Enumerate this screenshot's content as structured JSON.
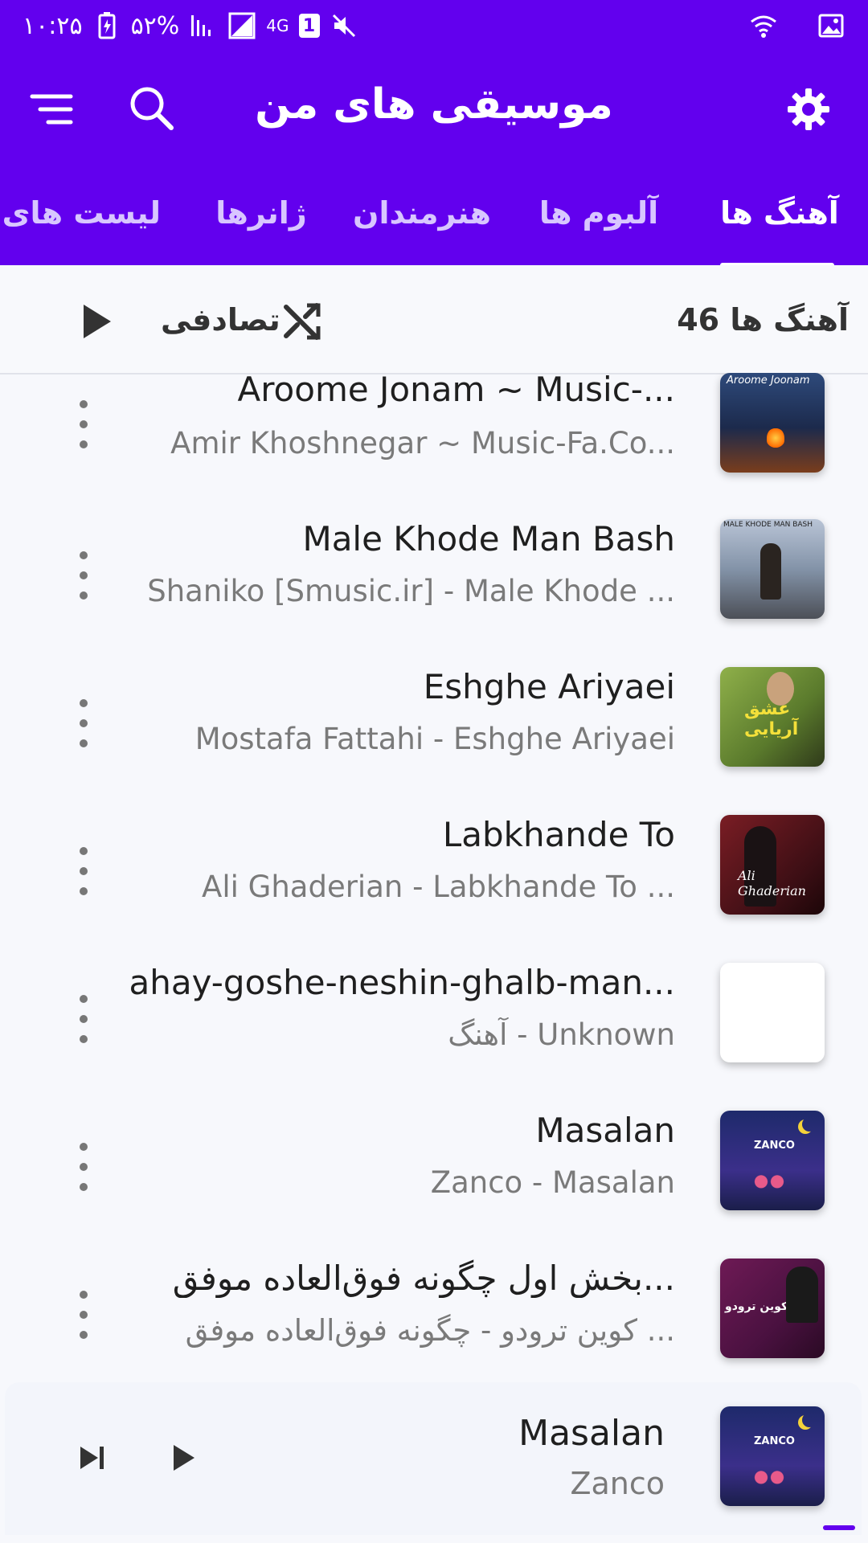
{
  "status_bar": {
    "time": "۱۰:۲۵",
    "battery": "۵۲%",
    "network": "4G",
    "sim": "1"
  },
  "app_bar": {
    "title": "موسیقی های من",
    "icons": [
      "menu-icon",
      "search-icon",
      "settings-icon"
    ]
  },
  "tabs": [
    {
      "label": "آهنگ ها",
      "active": true
    },
    {
      "label": "آلبوم ها",
      "active": false
    },
    {
      "label": "هنرمندان",
      "active": false
    },
    {
      "label": "ژانرها",
      "active": false
    },
    {
      "label": "لیست های پ",
      "active": false
    }
  ],
  "controls": {
    "count_label": "46 آهنگ ها",
    "shuffle_label": "تصادفی"
  },
  "songs": [
    {
      "title": "Aroome Jonam ~ Music-...",
      "subtitle": "Amir Khoshnegar ~ Music-Fa.Co...",
      "art": "campfire",
      "art_text": "Aroome Joonam"
    },
    {
      "title": "Male Khode Man Bash",
      "subtitle": "Shaniko [Smusic.ir] - Male Khode ...",
      "art": "mountain",
      "art_text": "MALE KHODE MAN BASH"
    },
    {
      "title": "Eshghe Ariyaei",
      "subtitle": "Mostafa Fattahi - Eshghe Ariyaei",
      "art": "green",
      "art_text": "عشق آریایی"
    },
    {
      "title": "Labkhande To",
      "subtitle": "Ali Ghaderian - Labkhande To ...",
      "art": "red",
      "art_text": "Ali Ghaderian"
    },
    {
      "title": "ahay-goshe-neshin-ghalb-man...",
      "subtitle": "آهنگ - Unknown",
      "art": "blank",
      "art_text": ""
    },
    {
      "title": "Masalan",
      "subtitle": "Zanco - Masalan",
      "art": "night",
      "art_text": "ZANCO"
    },
    {
      "title": "بخش اول چگونه فوق‌العاده موفق...",
      "subtitle": "کوین ترودو - چگونه فوق‌العاده موفق ...",
      "art": "purple",
      "art_text": "کوین ترودو"
    }
  ],
  "now_playing": {
    "title": "Masalan",
    "artist": "Zanco",
    "art_text": "ZANCO"
  },
  "colors": {
    "primary": "#6200ee",
    "background": "#f7f8fc"
  }
}
